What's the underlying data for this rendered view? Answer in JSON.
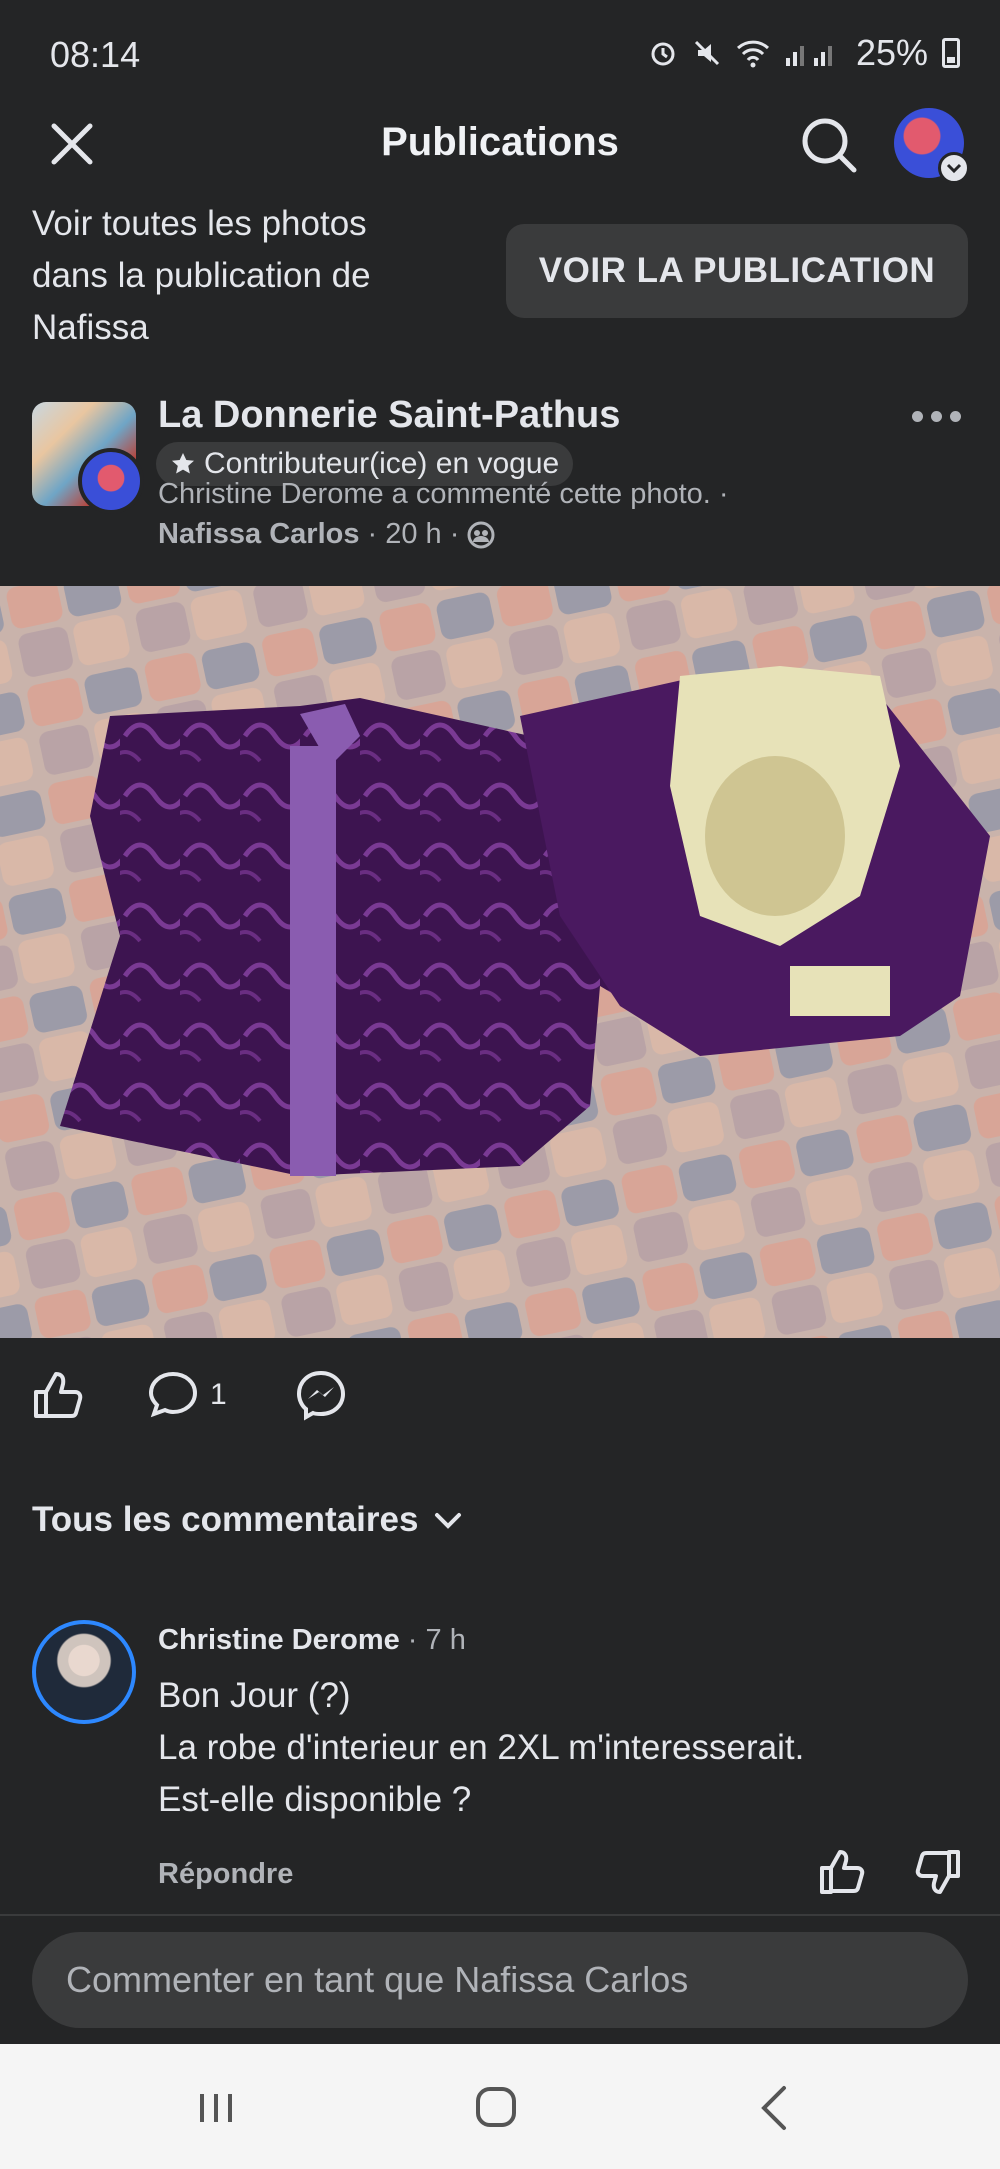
{
  "status_bar": {
    "time": "08:14",
    "battery": "25%"
  },
  "app_bar": {
    "title": "Publications"
  },
  "banner": {
    "text": "Voir toutes les photos dans la publication de Nafissa",
    "button_label": "VOIR LA PUBLICATION"
  },
  "post": {
    "group_name": "La Donnerie Saint-Pathus",
    "badge_label": "Contributeur(ice) en vogue",
    "activity_note": "Christine Derome a commenté cette photo. ·",
    "author": "Nafissa Carlos",
    "time": "· 20 h ·",
    "comment_count": "1"
  },
  "comments": {
    "filter_label": "Tous les commentaires",
    "items": [
      {
        "name": "Christine Derome",
        "time": "· 7 h",
        "text": "Bon Jour (?)\nLa robe d'interieur en 2XL m'interesserait.\nEst-elle disponible ?",
        "reply_label": "Répondre"
      }
    ]
  },
  "composer": {
    "placeholder": "Commenter en tant que Nafissa Carlos"
  },
  "colors": {
    "background": "#242526",
    "accent": "#2d88ff",
    "surface": "#3a3b3c"
  }
}
